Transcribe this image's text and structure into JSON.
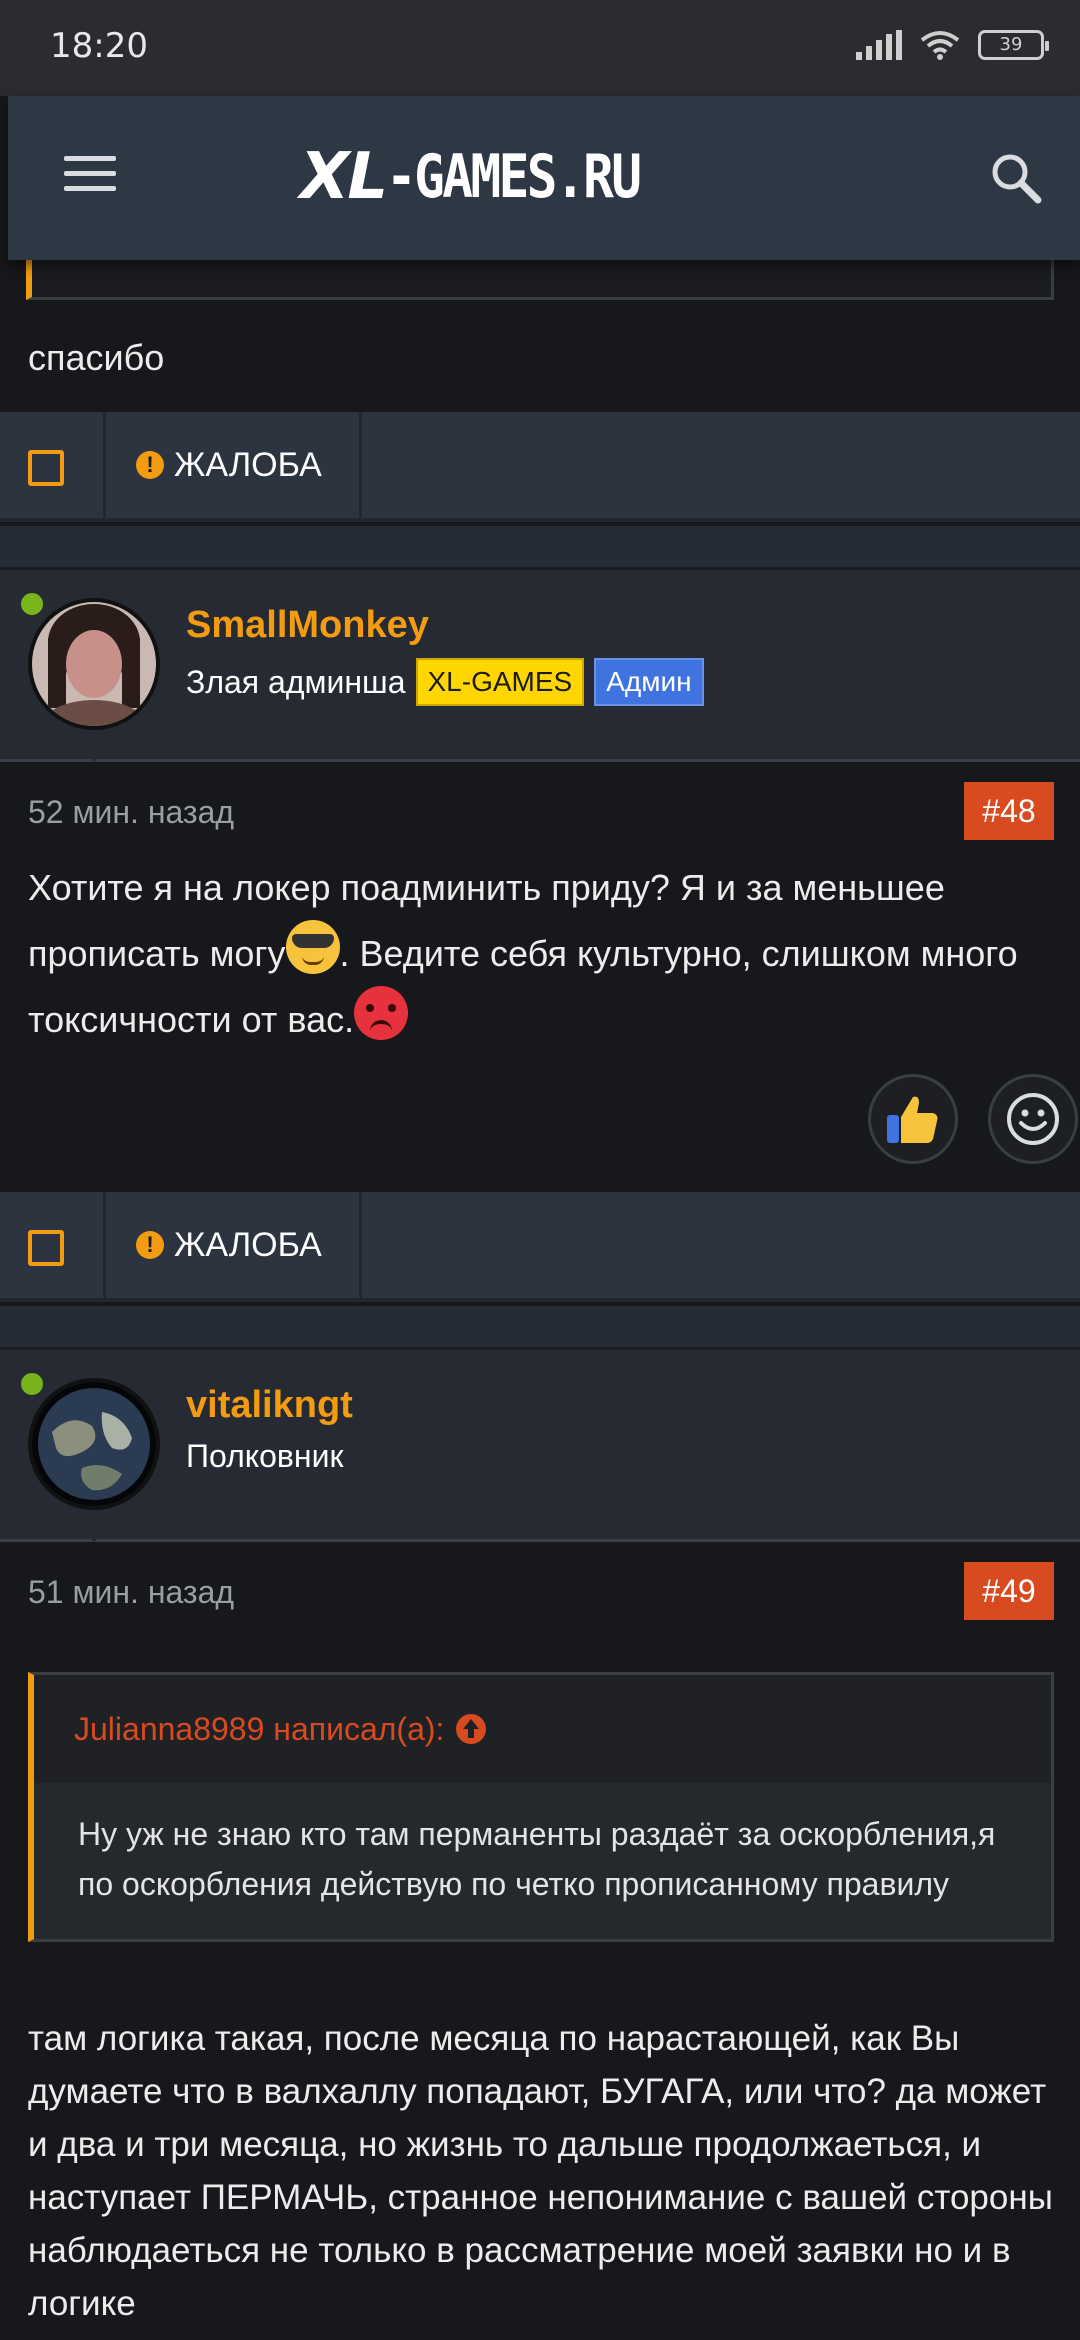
{
  "status_bar": {
    "time": "18:20",
    "battery": "39"
  },
  "header": {
    "logo_xl": "XL",
    "logo_rest": "-GAMES.RU"
  },
  "top_post": {
    "text": "спасибо"
  },
  "actions": [
    {
      "report_label": "ЖАЛОБА"
    },
    {
      "report_label": "ЖАЛОБА"
    }
  ],
  "post48": {
    "username": "SmallMonkey",
    "user_title": "Злая админша",
    "badge1": "XL-GAMES",
    "badge2": "Админ",
    "time": "52 мин. назад",
    "number": "#48",
    "text_part1": "Хотите я на локер поадминить приду? Я и за меньшее прописать могу",
    "text_part2": ". Ведите себя культурно, слишком много токсичности от вас.",
    "reactions": [
      "thumbs-up",
      "smile"
    ]
  },
  "post49": {
    "username": "vitalikngt",
    "user_title": "Полковник",
    "time": "51 мин. назад",
    "number": "#49",
    "quote_author": "Julianna8989 написал(а):",
    "quote_text": "Ну уж не знаю кто там перманенты раздаёт за оскорбления,я по оскорбления действую по четко прописанному правилу",
    "text": "там логика такая, после месяца по нарастающей, как Вы думаете что в валхаллу попадают, БУГАГА, или что? да может и два и три месяца, но жизнь то дальше продолжаеться, и наступает ПЕРМАЧЬ, странное непонимание с вашей стороны наблюдаеться не только в рассматрение моей заявки но и в логике"
  },
  "colors": {
    "accent": "#f39c12",
    "number_badge": "#d84a1f",
    "online": "#7ab41d",
    "header_bg": "#2e3744"
  }
}
